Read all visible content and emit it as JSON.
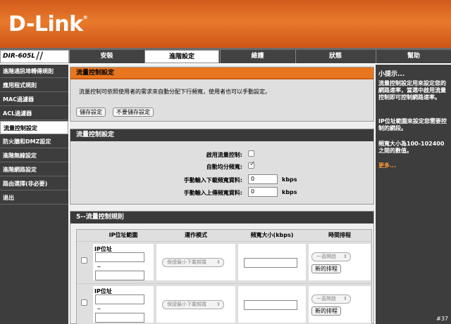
{
  "brand": {
    "logo": "D-Link",
    "model": "DIR-605L"
  },
  "topnav": [
    "安裝",
    "進階設定",
    "維護",
    "狀態",
    "幫助"
  ],
  "sidebar": [
    "進階通訊埠轉傳規則",
    "應用程式規則",
    "MAC過濾器",
    "ACL過濾器",
    "流量控制設定",
    "防火牆和DMZ設定",
    "進階無線設定",
    "進階網路設定",
    "路由選擇(非必要)",
    "退出"
  ],
  "intro": {
    "title": "流量控制設定",
    "description": "流量控制可依照使用者的需求來自動分配下行頻寬，使用者也可以手動設定。",
    "save_label": "儲存設定",
    "nosave_label": "不要儲存設定"
  },
  "settings": {
    "title": "流量控制設定",
    "enable_label": "啟用流量控制:",
    "enable_checked": false,
    "auto_label": "自動均分頻寬:",
    "auto_checked": true,
    "down_label": "手動輸入下載頻寬資料:",
    "down_value": "0",
    "up_label": "手動輸入上傳頻寬資料:",
    "up_value": "0",
    "unit": "kbps"
  },
  "rules": {
    "title": "5--流量控制規則",
    "headers": [
      "IP位址範圍",
      "運作模式",
      "頻寬大小(kbps)",
      "時間排程"
    ],
    "row_ip_label": "IP位址",
    "tilde": "~",
    "mode_option": "保證最小下載頻寬",
    "schedule_option": "一直開啟",
    "new_schedule_label": "新的排程"
  },
  "hints": {
    "title": "小提示...",
    "p1": "流量控制設定用來設定您的網路速率，當選中啟用流量控制即可控制網路速率。",
    "p2": "IP位址範圍來設定您需要控制的網段。",
    "p3": "頻寬大小為100-102400之間的數值。",
    "more": "更多..."
  },
  "corner_label": "#37"
}
